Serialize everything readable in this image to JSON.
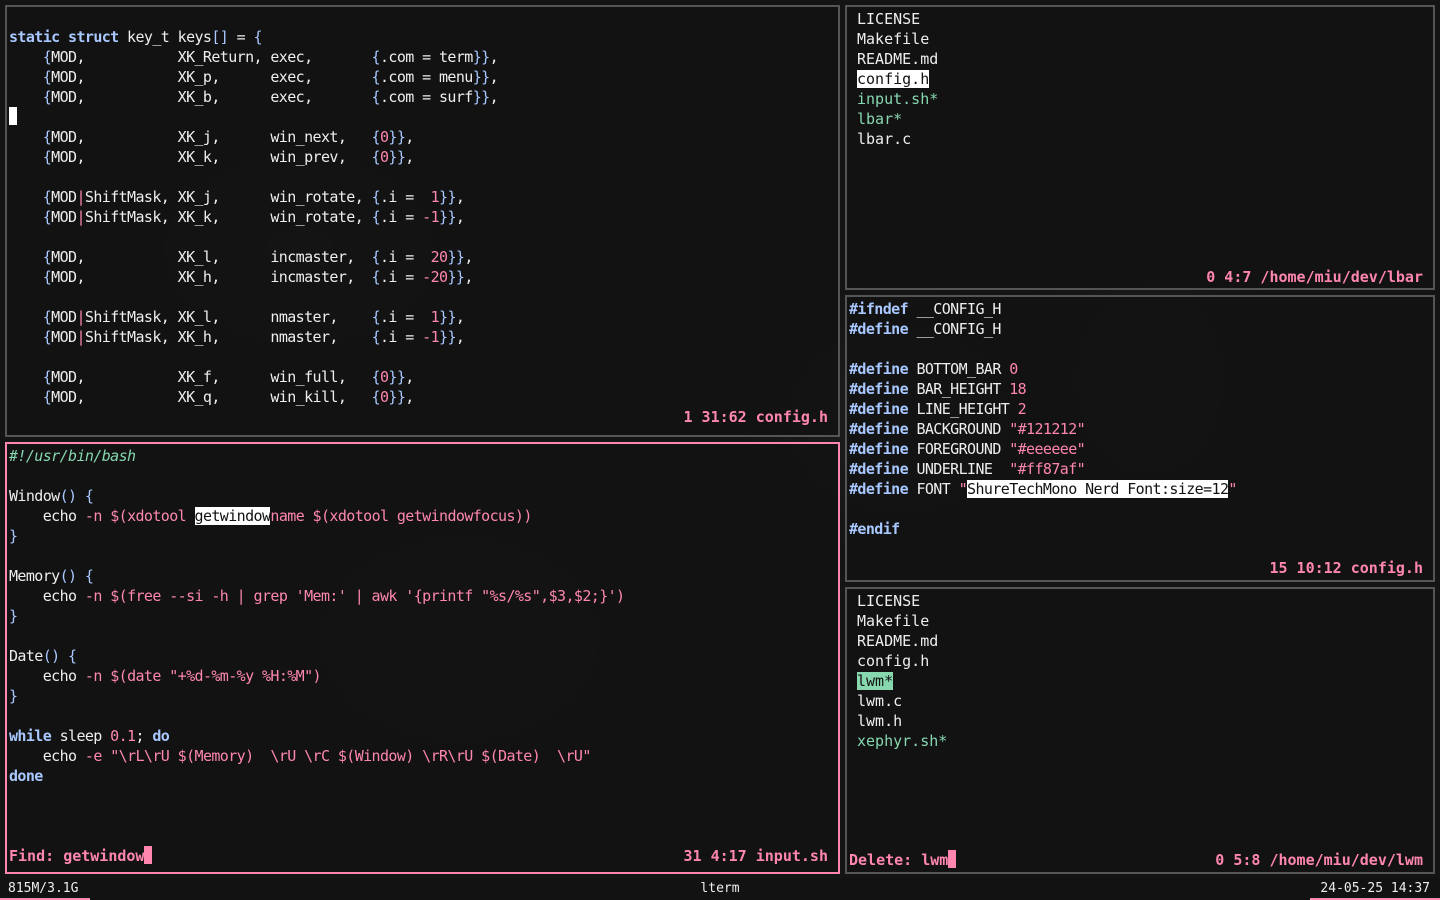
{
  "app": {
    "title": "lterm"
  },
  "windows": {
    "config_keys": {
      "status": "1 31:62 config.h"
    },
    "input_sh": {
      "prompt_label": "Find: ",
      "prompt_value": "getwindow",
      "status": "31 4:17 input.sh"
    },
    "lbar_dir": {
      "files": [
        {
          "name": "LICENSE",
          "style": "normal"
        },
        {
          "name": "Makefile",
          "style": "normal"
        },
        {
          "name": "README.md",
          "style": "normal"
        },
        {
          "name": "config.h",
          "style": "selected"
        },
        {
          "name": "input.sh*",
          "style": "exec"
        },
        {
          "name": "lbar*",
          "style": "exec"
        },
        {
          "name": "lbar.c",
          "style": "normal"
        }
      ],
      "status": "0 4:7 /home/miu/dev/lbar"
    },
    "config_header": {
      "status": "15 10:12 config.h"
    },
    "lwm_dir": {
      "files": [
        {
          "name": "LICENSE",
          "style": "normal"
        },
        {
          "name": "Makefile",
          "style": "normal"
        },
        {
          "name": "README.md",
          "style": "normal"
        },
        {
          "name": "config.h",
          "style": "normal"
        },
        {
          "name": "lwm*",
          "style": "exec-selected"
        },
        {
          "name": "lwm.c",
          "style": "normal"
        },
        {
          "name": "lwm.h",
          "style": "normal"
        },
        {
          "name": "xephyr.sh*",
          "style": "exec"
        }
      ],
      "prompt_label": "Delete: ",
      "prompt_value": "lwm",
      "status": "0 5:8 /home/miu/dev/lwm"
    }
  },
  "bar": {
    "left": "815M/3.1G",
    "center": "lterm",
    "right": "24-05-25 14:37"
  },
  "colors": {
    "accent": "#ff87af",
    "keyword": "#a8c8ff",
    "exec": "#87d7af",
    "foreground": "#eeeeee",
    "background": "#121212"
  }
}
